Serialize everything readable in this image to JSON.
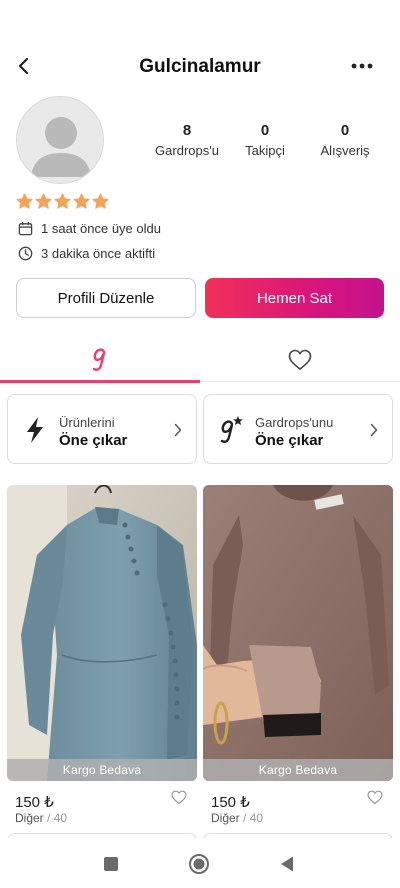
{
  "header": {
    "title": "Gulcinalamur",
    "back_icon": "chevron-left-icon",
    "more_icon": "more-horizontal-icon"
  },
  "profile": {
    "stats": [
      {
        "value": "8",
        "label": "Gardrops'u"
      },
      {
        "value": "0",
        "label": "Takipçi"
      },
      {
        "value": "0",
        "label": "Alışveriş"
      }
    ],
    "rating": 5,
    "joined": "1 saat önce üye oldu",
    "last_active": "3 dakika önce aktifti"
  },
  "actions": {
    "edit_label": "Profili Düzenle",
    "sell_label": "Hemen Sat"
  },
  "tabs": [
    {
      "icon": "gardrops-g-icon",
      "active": true
    },
    {
      "icon": "heart-icon",
      "active": false
    }
  ],
  "promos": [
    {
      "line1": "Ürünlerini",
      "line2": "Öne çıkar",
      "icon": "lightning-icon"
    },
    {
      "line1": "Gardrops'unu",
      "line2": "Öne çıkar",
      "icon": "g-star-icon"
    }
  ],
  "products": [
    {
      "shipping": "Kargo Bedava",
      "price": "150 ₺",
      "category": "Diğer",
      "size": "40",
      "liked": false
    },
    {
      "shipping": "Kargo Bedava",
      "price": "150 ₺",
      "category": "Diğer",
      "size": "40",
      "liked": false
    }
  ],
  "colors": {
    "accent": "#f03e6c",
    "star": "#f4a35a",
    "gradient_start": "#f2305a",
    "gradient_end": "#c4138e"
  },
  "system_nav": [
    "recents-square-icon",
    "home-circle-icon",
    "back-triangle-icon"
  ]
}
